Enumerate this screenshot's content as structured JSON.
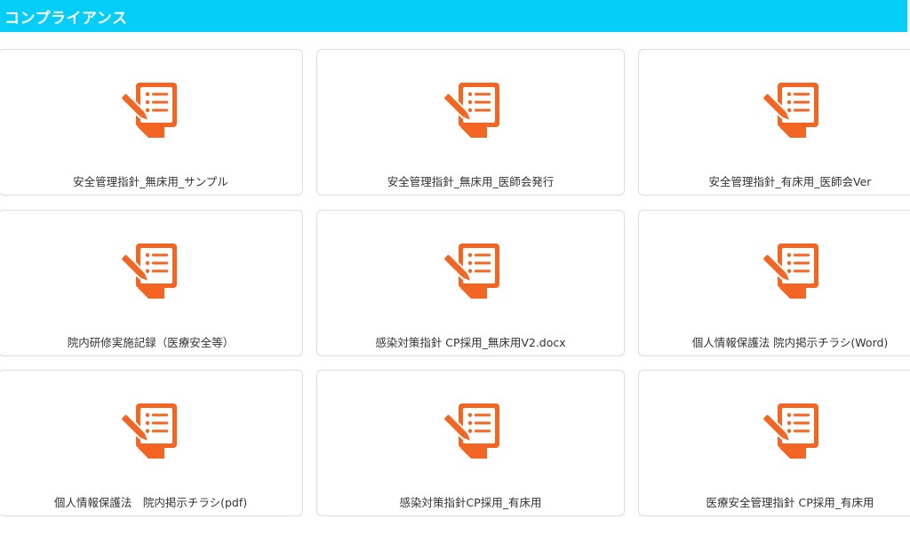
{
  "header": {
    "title": "コンプライアンス"
  },
  "accent_color": "#04cdf7",
  "icon_color": "#f26522",
  "cards": [
    {
      "label": "安全管理指針_無床用_サンプル",
      "icon": "document-edit-icon"
    },
    {
      "label": "安全管理指針_無床用_医師会発行",
      "icon": "document-edit-icon"
    },
    {
      "label": "安全管理指針_有床用_医師会Ver",
      "icon": "document-edit-icon"
    },
    {
      "label": "院内研修実施記録（医療安全等）",
      "icon": "document-edit-icon"
    },
    {
      "label": "感染対策指針 CP採用_無床用V2.docx",
      "icon": "document-edit-icon"
    },
    {
      "label": "個人情報保護法 院内掲示チラシ(Word)",
      "icon": "document-edit-icon"
    },
    {
      "label": "個人情報保護法　院内掲示チラシ(pdf)",
      "icon": "document-edit-icon"
    },
    {
      "label": "感染対策指針CP採用_有床用",
      "icon": "document-edit-icon"
    },
    {
      "label": "医療安全管理指針 CP採用_有床用",
      "icon": "document-edit-icon"
    }
  ]
}
